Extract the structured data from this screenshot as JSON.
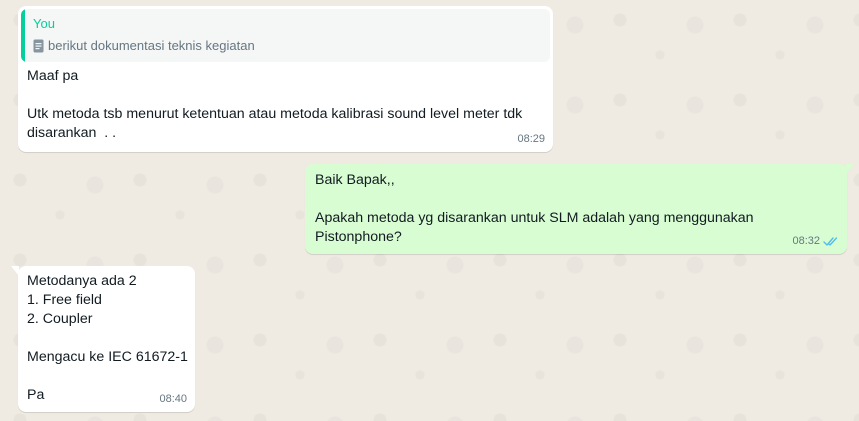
{
  "colors": {
    "wallpaper": "#efeae2",
    "incoming_bubble": "#ffffff",
    "outgoing_bubble": "#d9fdd3",
    "quote_accent": "#06cf9c",
    "timestamp": "#667781",
    "read_ticks": "#53bdeb"
  },
  "messages": [
    {
      "direction": "incoming",
      "quote": {
        "author": "You",
        "icon": "document-icon",
        "text": "berikut dokumentasi teknis kegiatan"
      },
      "text": "Maaf pa\n\nUtk metoda tsb menurut ketentuan atau metoda kalibrasi sound level meter tdk disarankan  . .",
      "time": "08:29"
    },
    {
      "direction": "outgoing",
      "text": "Baik Bapak,,\n\nApakah metoda yg disarankan untuk SLM adalah yang menggunakan Pistonphone?",
      "time": "08:32",
      "status_icon": "double-check-read-icon"
    },
    {
      "direction": "incoming",
      "text": "Metodanya ada 2\n1. Free field\n2. Coupler\n\nMengacu ke IEC 61672-1\n\nPa",
      "time": "08:40"
    }
  ]
}
